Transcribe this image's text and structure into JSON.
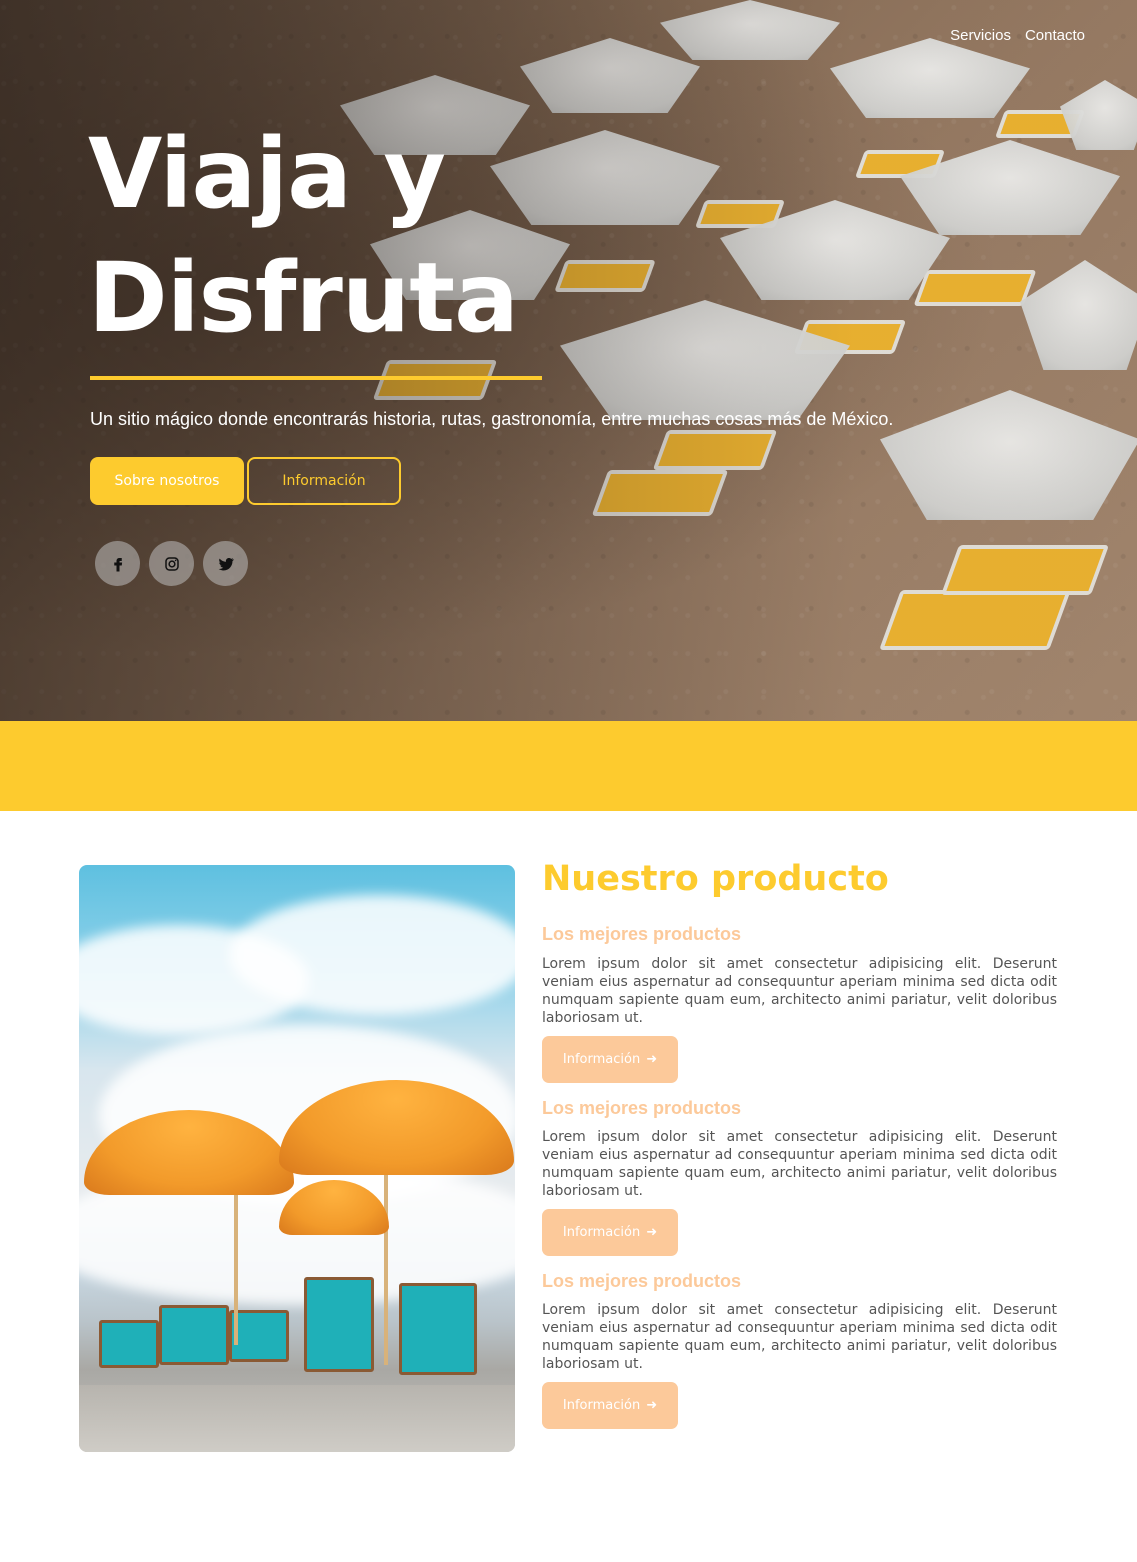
{
  "nav": {
    "items": [
      "Servicios",
      "Contacto"
    ]
  },
  "hero": {
    "title_line1": "Viaja y",
    "title_line2": "Disfruta",
    "subtitle": "Un sitio mágico donde encontrarás historia, rutas, gastronomía, entre muchas cosas más de México.",
    "primary_button": "Sobre nosotros",
    "secondary_button": "Información",
    "social_icons": [
      "facebook-icon",
      "instagram-icon",
      "twitter-icon"
    ]
  },
  "product": {
    "title": "Nuestro producto",
    "items": [
      {
        "title": "Los mejores productos",
        "text": "Lorem ipsum dolor sit amet consectetur adipisicing elit. Deserunt veniam eius aspernatur ad consequuntur aperiam minima sed dicta odit numquam sapiente quam eum, architecto animi pariatur, velit doloribus laboriosam ut.",
        "button": "Información"
      },
      {
        "title": "Los mejores productos",
        "text": "Lorem ipsum dolor sit amet consectetur adipisicing elit. Deserunt veniam eius aspernatur ad consequuntur aperiam minima sed dicta odit numquam sapiente quam eum, architecto animi pariatur, velit doloribus laboriosam ut.",
        "button": "Información"
      },
      {
        "title": "Los mejores productos",
        "text": "Lorem ipsum dolor sit amet consectetur adipisicing elit. Deserunt veniam eius aspernatur ad consequuntur aperiam minima sed dicta odit numquam sapiente quam eum, architecto animi pariatur, velit doloribus laboriosam ut.",
        "button": "Información"
      }
    ]
  },
  "colors": {
    "accent_yellow": "#fdcb2e",
    "accent_peach": "#fcc99a",
    "band": "#fdcb2e"
  }
}
